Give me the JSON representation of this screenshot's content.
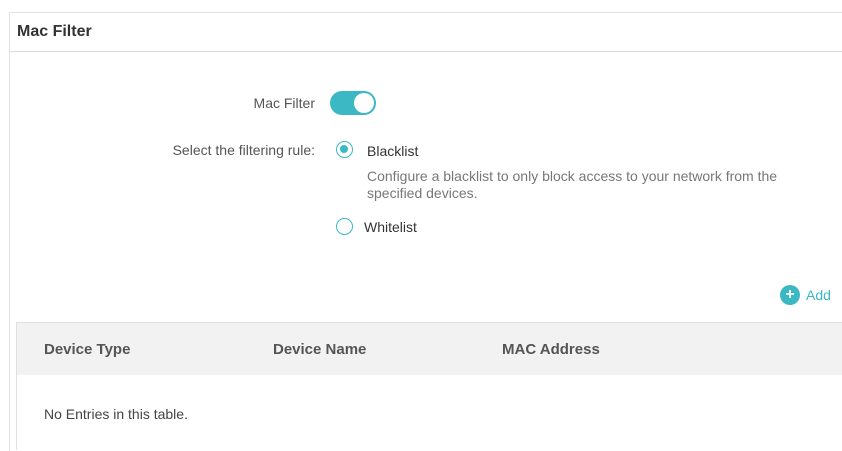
{
  "header": {
    "title": "Mac Filter"
  },
  "mac_filter": {
    "label": "Mac Filter",
    "enabled": true
  },
  "filtering_rule": {
    "label": "Select the filtering rule:",
    "options": [
      {
        "label": "Blacklist",
        "selected": true
      },
      {
        "label": "Whitelist",
        "selected": false
      }
    ],
    "description": "Configure a blacklist to only block access to your network from the specified devices."
  },
  "actions": {
    "add_label": "Add"
  },
  "table": {
    "columns": [
      "Device Type",
      "Device Name",
      "MAC Address"
    ],
    "empty_message": "No Entries in this table."
  },
  "colors": {
    "accent": "#3cb7c4"
  }
}
